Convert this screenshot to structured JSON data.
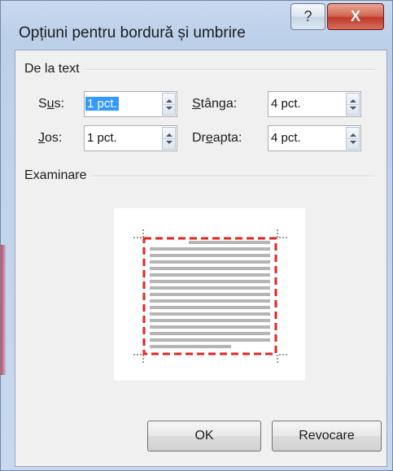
{
  "window": {
    "title": "Opțiuni pentru bordură și umbrire",
    "help_glyph": "?",
    "close_glyph": "X"
  },
  "from_text_group": {
    "label": "De la text",
    "fields": {
      "top": {
        "label_pre": "S",
        "label_ul": "u",
        "label_post": "s:",
        "value": "1 pct."
      },
      "bottom": {
        "label_pre": "",
        "label_ul": "J",
        "label_post": "os:",
        "value": "1 pct."
      },
      "left": {
        "label_pre": "",
        "label_ul": "S",
        "label_post": "tânga:",
        "value": "4 pct."
      },
      "right": {
        "label_pre": "Dr",
        "label_ul": "e",
        "label_post": "apta:",
        "value": "4 pct."
      }
    }
  },
  "preview_group": {
    "label": "Examinare",
    "border_color": "#e0261f",
    "text_line_color": "#b5b5b5"
  },
  "buttons": {
    "ok": "OK",
    "cancel": "Revocare"
  },
  "icons": {
    "help": "help-icon",
    "close": "close-icon",
    "spin_up": "arrow-up-icon",
    "spin_down": "arrow-down-icon"
  }
}
